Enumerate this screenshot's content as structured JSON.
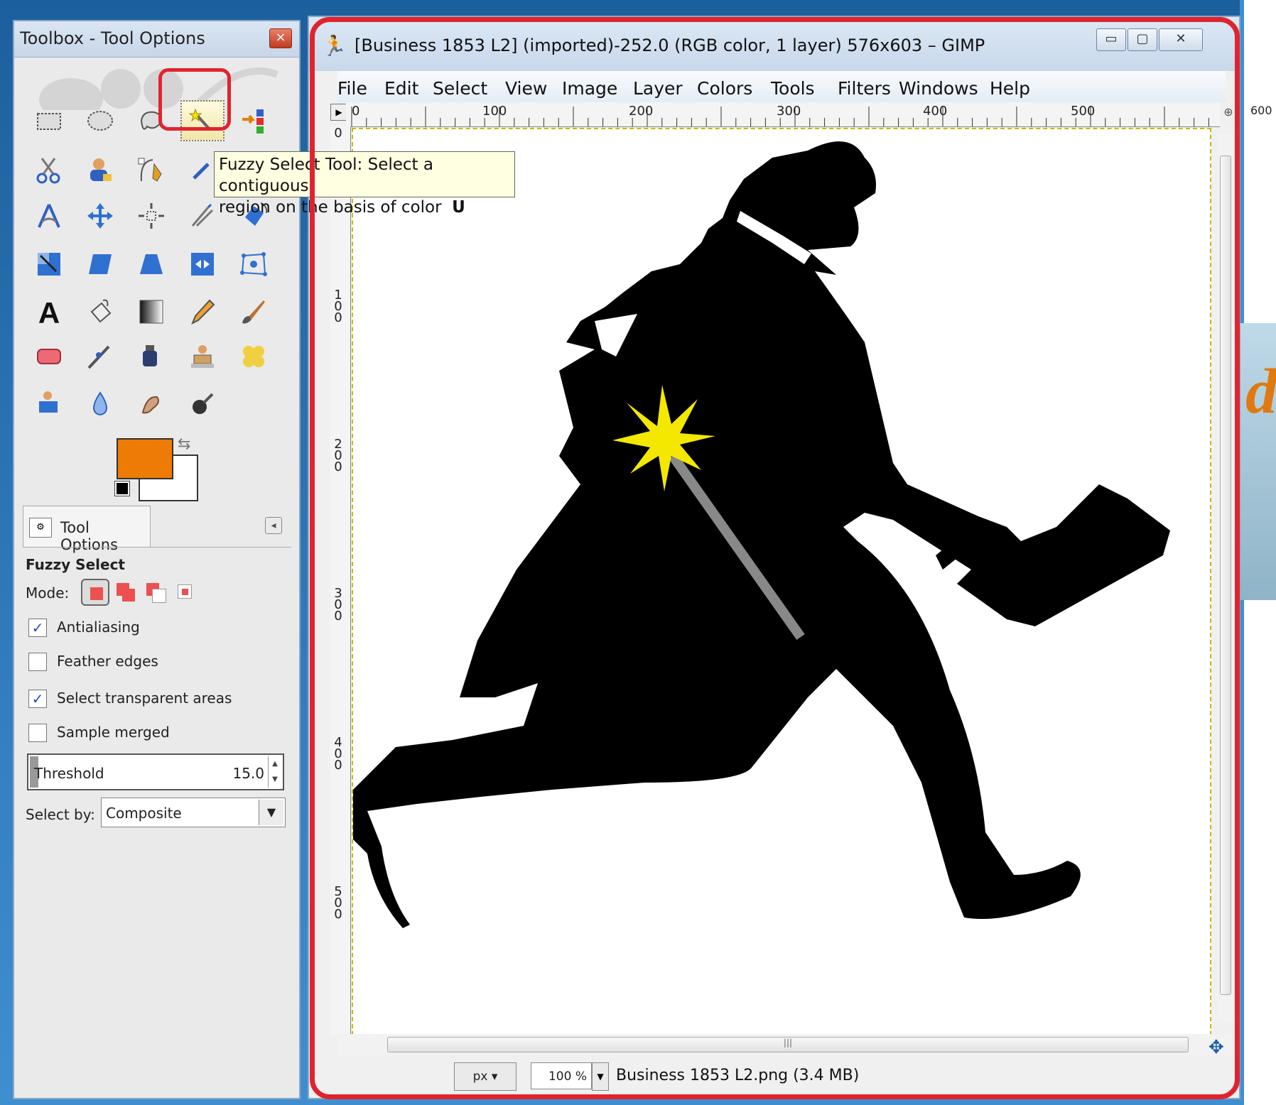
{
  "toolbox": {
    "title": "Toolbox - Tool Options",
    "close_label": "×",
    "tooltip_line1": "Fuzzy Select Tool: Select a contiguous",
    "tooltip_line2": "region on the basis of color",
    "tooltip_shortcut": "U",
    "foreground_color": "#ee7b06",
    "background_color": "#ffffff",
    "tools": [
      "rect-select-icon",
      "ellipse-select-icon",
      "free-select-icon",
      "fuzzy-select-icon",
      "select-by-color-icon",
      "scissors-select-icon",
      "foreground-select-icon",
      "paths-icon",
      "color-picker-icon",
      "zoom-icon",
      "measure-icon",
      "move-icon",
      "alignment-icon",
      "crop-icon",
      "rotate-icon",
      "scale-icon",
      "shear-icon",
      "perspective-icon",
      "flip-icon",
      "cage-transform-icon",
      "text-icon",
      "bucket-fill-icon",
      "gradient-icon",
      "pencil-icon",
      "paintbrush-icon",
      "eraser-icon",
      "airbrush-icon",
      "ink-icon",
      "clone-icon",
      "heal-icon",
      "perspective-clone-icon",
      "blur-icon",
      "smudge-icon",
      "dodge-burn-icon"
    ]
  },
  "tool_options": {
    "tab_label": "Tool Options",
    "heading": "Fuzzy Select",
    "mode_label": "Mode:",
    "antialiasing": "Antialiasing",
    "feather_edges": "Feather edges",
    "select_transparent": "Select transparent areas",
    "sample_merged": "Sample merged",
    "threshold_label": "Threshold",
    "threshold_value": "15.0",
    "select_by_label": "Select by:",
    "select_by_value": "Composite",
    "checks": {
      "antialiasing": true,
      "feather_edges": false,
      "select_transparent": true,
      "sample_merged": false
    }
  },
  "window": {
    "title": "[Business 1853 L2] (imported)-252.0 (RGB color, 1 layer) 576x603 – GIMP",
    "min": "▭",
    "max": "▢",
    "close": "✕"
  },
  "menu": {
    "file": "File",
    "edit": "Edit",
    "select": "Select",
    "view": "View",
    "image": "Image",
    "layer": "Layer",
    "colors": "Colors",
    "tools": "Tools",
    "filters": "Filters",
    "windows": "Windows",
    "help": "Help"
  },
  "ruler": {
    "top": [
      "0",
      "100",
      "200",
      "300",
      "400",
      "500",
      "600"
    ],
    "left": [
      "0",
      "100",
      "200",
      "300",
      "400",
      "500"
    ]
  },
  "status": {
    "unit": "px",
    "zoom": "100 %",
    "file_info": "Business 1853 L2.png (3.4 MB)"
  }
}
